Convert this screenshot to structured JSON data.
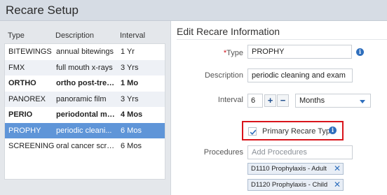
{
  "window": {
    "title": "Recare Setup"
  },
  "table": {
    "headers": [
      "Type",
      "Description",
      "Interval"
    ],
    "rows": [
      {
        "type": "BITEWINGS",
        "description": "annual bitewings",
        "interval": "1 Yr",
        "bold": false,
        "selected": false
      },
      {
        "type": "FMX",
        "description": "full mouth x-rays",
        "interval": "3 Yrs",
        "bold": false,
        "selected": false
      },
      {
        "type": "ORTHO",
        "description": "ortho post-trea...",
        "interval": "1 Mo",
        "bold": true,
        "selected": false
      },
      {
        "type": "PANOREX",
        "description": "panoramic film",
        "interval": "3 Yrs",
        "bold": false,
        "selected": false
      },
      {
        "type": "PERIO",
        "description": "periodontal ma...",
        "interval": "4 Mos",
        "bold": true,
        "selected": false
      },
      {
        "type": "PROPHY",
        "description": "periodic cleani...",
        "interval": "6 Mos",
        "bold": false,
        "selected": true
      },
      {
        "type": "SCREENING",
        "description": "oral cancer scre...",
        "interval": "6 Mos",
        "bold": false,
        "selected": false
      }
    ]
  },
  "form": {
    "title": "Edit Recare Information",
    "type_label": "Type",
    "type_required_mark": "*",
    "type_value": "PROPHY",
    "description_label": "Description",
    "description_value": "periodic cleaning and exam",
    "interval_label": "Interval",
    "interval_value": "6",
    "plus_label": "+",
    "minus_label": "−",
    "interval_unit": "Months",
    "primary_label": "Primary Recare Type",
    "primary_checked": true,
    "procedures_label": "Procedures",
    "procedures_placeholder": "Add Procedures",
    "procedures": [
      {
        "label": "D1110 Prophylaxis - Adult"
      },
      {
        "label": "D1120 Prophylaxis - Child"
      }
    ],
    "chip_remove_glyph": "✕",
    "info_glyph": "i"
  },
  "colors": {
    "selected_row": "#5f95d8",
    "accent": "#2f6fbd",
    "highlight_border": "#d9141b"
  }
}
